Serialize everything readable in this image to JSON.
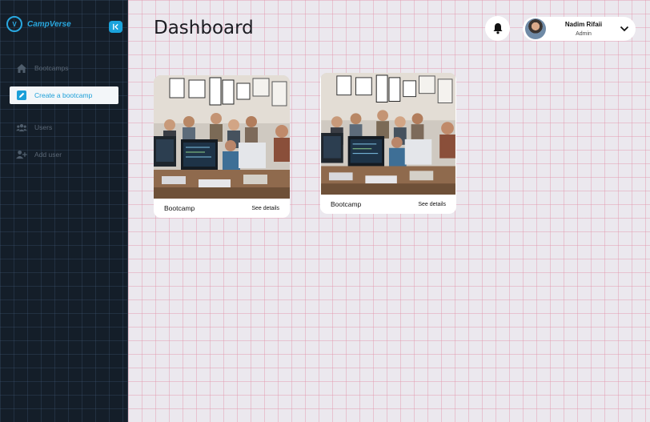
{
  "brand": {
    "name": "CampVerse"
  },
  "sidebar": {
    "items": [
      {
        "label": "Bootcamps",
        "icon": "home-icon",
        "active": false
      },
      {
        "label": "Create a bootcamp",
        "icon": "pencil-icon",
        "active": true
      },
      {
        "label": "Users",
        "icon": "users-icon",
        "active": false
      },
      {
        "label": "Add user",
        "icon": "add-user-icon",
        "active": false
      }
    ]
  },
  "header": {
    "title": "Dashboard",
    "user": {
      "name": "Nadim Rifaii",
      "role": "Admin"
    }
  },
  "cards": [
    {
      "title": "Bootcamp",
      "link": "See details"
    },
    {
      "title": "Bootcamp",
      "link": "See details"
    }
  ],
  "colors": {
    "accent": "#1aa3dc",
    "sidebar_bg": "#141e29",
    "main_bg": "#ebe8ee"
  }
}
